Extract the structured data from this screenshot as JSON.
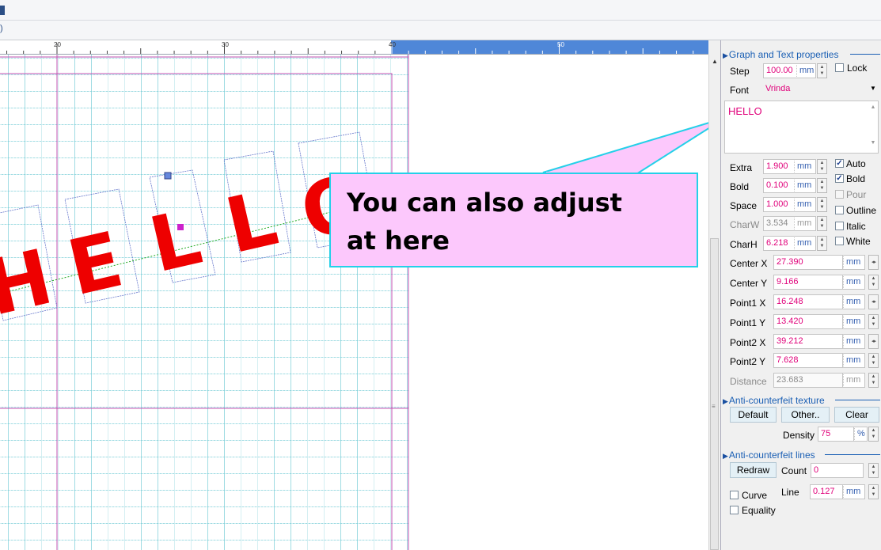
{
  "ruler": {
    "labels": [
      "20",
      "30",
      "40",
      "50"
    ]
  },
  "callout": {
    "line1": "You can also adjust",
    "line2": "at here"
  },
  "canvas": {
    "text": "HELLO"
  },
  "panel": {
    "graph_text": {
      "header": "Graph and Text properties",
      "step_label": "Step",
      "step_value": "100.00",
      "step_unit": "mm",
      "lock_label": "Lock",
      "font_label": "Font",
      "font_value": "Vrinda",
      "text_value": "HELLO",
      "extra_label": "Extra",
      "extra_value": "1.900",
      "extra_unit": "mm",
      "bold_label": "Bold",
      "bold_value": "0.100",
      "bold_unit": "mm",
      "space_label": "Space",
      "space_value": "1.000",
      "space_unit": "mm",
      "charw_label": "CharW",
      "charw_value": "3.534",
      "charw_unit": "mm",
      "charh_label": "CharH",
      "charh_value": "6.218",
      "charh_unit": "mm",
      "auto_label": "Auto",
      "auto_checked": true,
      "boldchk_label": "Bold",
      "boldchk_checked": true,
      "pour_label": "Pour",
      "pour_checked": false,
      "outline_label": "Outline",
      "outline_checked": false,
      "italic_label": "Italic",
      "italic_checked": false,
      "white_label": "White",
      "white_checked": false,
      "centerx_label": "Center X",
      "centerx_value": "27.390",
      "centery_label": "Center Y",
      "centery_value": "9.166",
      "p1x_label": "Point1 X",
      "p1x_value": "16.248",
      "p1y_label": "Point1 Y",
      "p1y_value": "13.420",
      "p2x_label": "Point2 X",
      "p2x_value": "39.212",
      "p2y_label": "Point2 Y",
      "p2y_value": "7.628",
      "dist_label": "Distance",
      "dist_value": "23.683",
      "unit": "mm"
    },
    "texture": {
      "header": "Anti-counterfeit texture",
      "default_label": "Default",
      "other_label": "Other..",
      "clear_label": "Clear",
      "density_label": "Density",
      "density_value": "75",
      "density_unit": "%"
    },
    "lines": {
      "header": "Anti-counterfeit lines",
      "redraw_label": "Redraw",
      "count_label": "Count",
      "count_value": "0",
      "curve_label": "Curve",
      "curve_checked": false,
      "line_label": "Line",
      "line_value": "0.127",
      "line_unit": "mm",
      "equality_label": "Equality",
      "equality_checked": false
    }
  },
  "colors": {
    "accent": "#1a5fb4",
    "value_text": "#e0007a",
    "letter_red": "#ee0000",
    "callout_fill": "#fcc8fc",
    "callout_border": "#24d0e8"
  }
}
